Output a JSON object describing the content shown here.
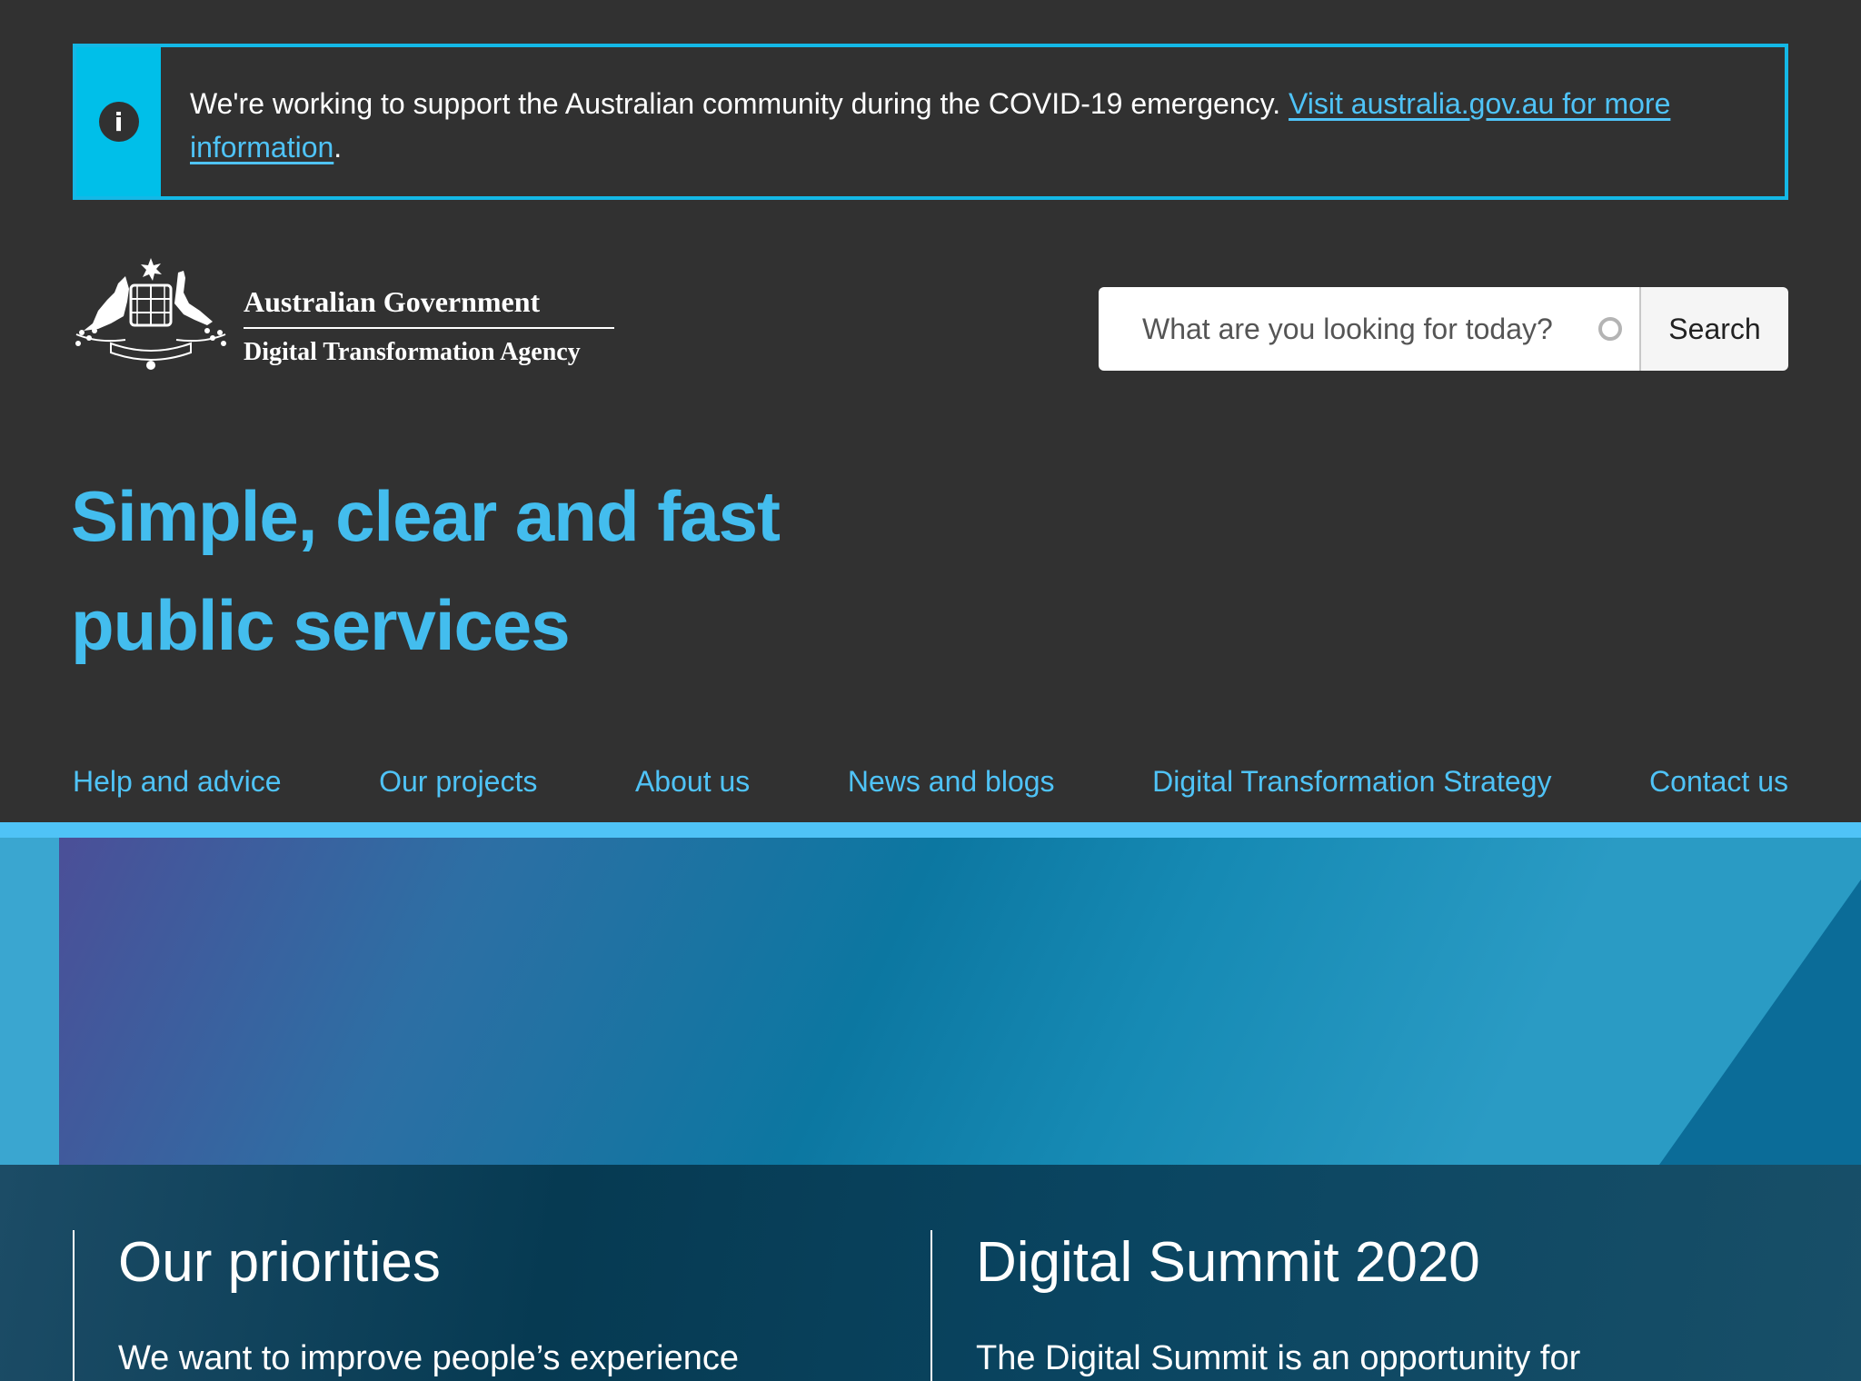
{
  "alert": {
    "icon": "info-icon",
    "icon_glyph": "i",
    "message": "We're working to support the Australian community during the COVID-19 emergency. ",
    "link_text": "Visit australia.gov.au for more information",
    "suffix": ".",
    "accent_color": "#00bfe9"
  },
  "brand": {
    "crest_icon": "coat-of-arms-icon",
    "line1": "Australian Government",
    "line2": "Digital Transformation Agency"
  },
  "search": {
    "placeholder": "What are you looking for today?",
    "button_label": "Search"
  },
  "hero": {
    "title": "Simple, clear and fast public services",
    "color": "#43bdee"
  },
  "nav": {
    "items": [
      {
        "label": "Help and advice"
      },
      {
        "label": "Our projects"
      },
      {
        "label": "About us"
      },
      {
        "label": "News and blogs"
      },
      {
        "label": "Digital Transformation Strategy"
      },
      {
        "label": "Contact us"
      }
    ],
    "link_color": "#4fc3f7"
  },
  "cards": [
    {
      "title": "Our priorities",
      "text": "We want to improve people’s experience"
    },
    {
      "title": "Digital Summit 2020",
      "text": "The Digital Summit is an opportunity for"
    }
  ]
}
